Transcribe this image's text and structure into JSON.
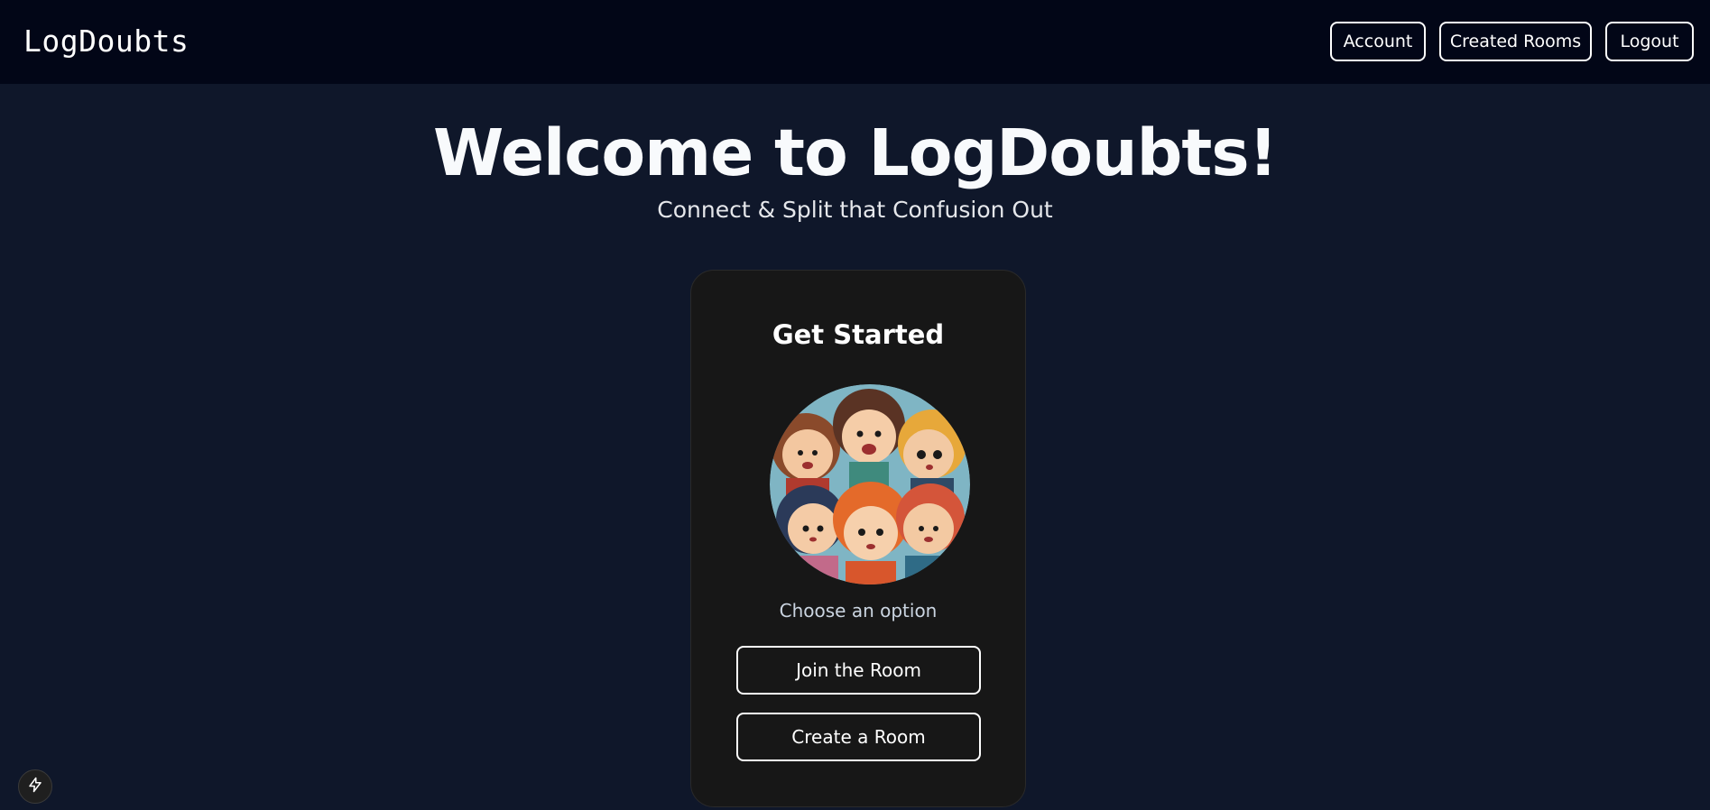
{
  "navbar": {
    "brand": "LogDoubts",
    "buttons": {
      "account": "Account",
      "created_rooms": "Created Rooms",
      "logout": "Logout"
    }
  },
  "hero": {
    "title": "Welcome to LogDoubts!",
    "subtitle": "Connect & Split that Confusion Out"
  },
  "card": {
    "title": "Get Started",
    "image_icon": "group-of-friends-illustration",
    "prompt": "Choose an option",
    "join_label": "Join the Room",
    "create_label": "Create a Room"
  },
  "dev_indicator": {
    "icon": "lightning-bolt-icon"
  },
  "colors": {
    "background": "#0f172a",
    "navbar": "#020617",
    "card": "#171717",
    "text": "#ffffff"
  }
}
